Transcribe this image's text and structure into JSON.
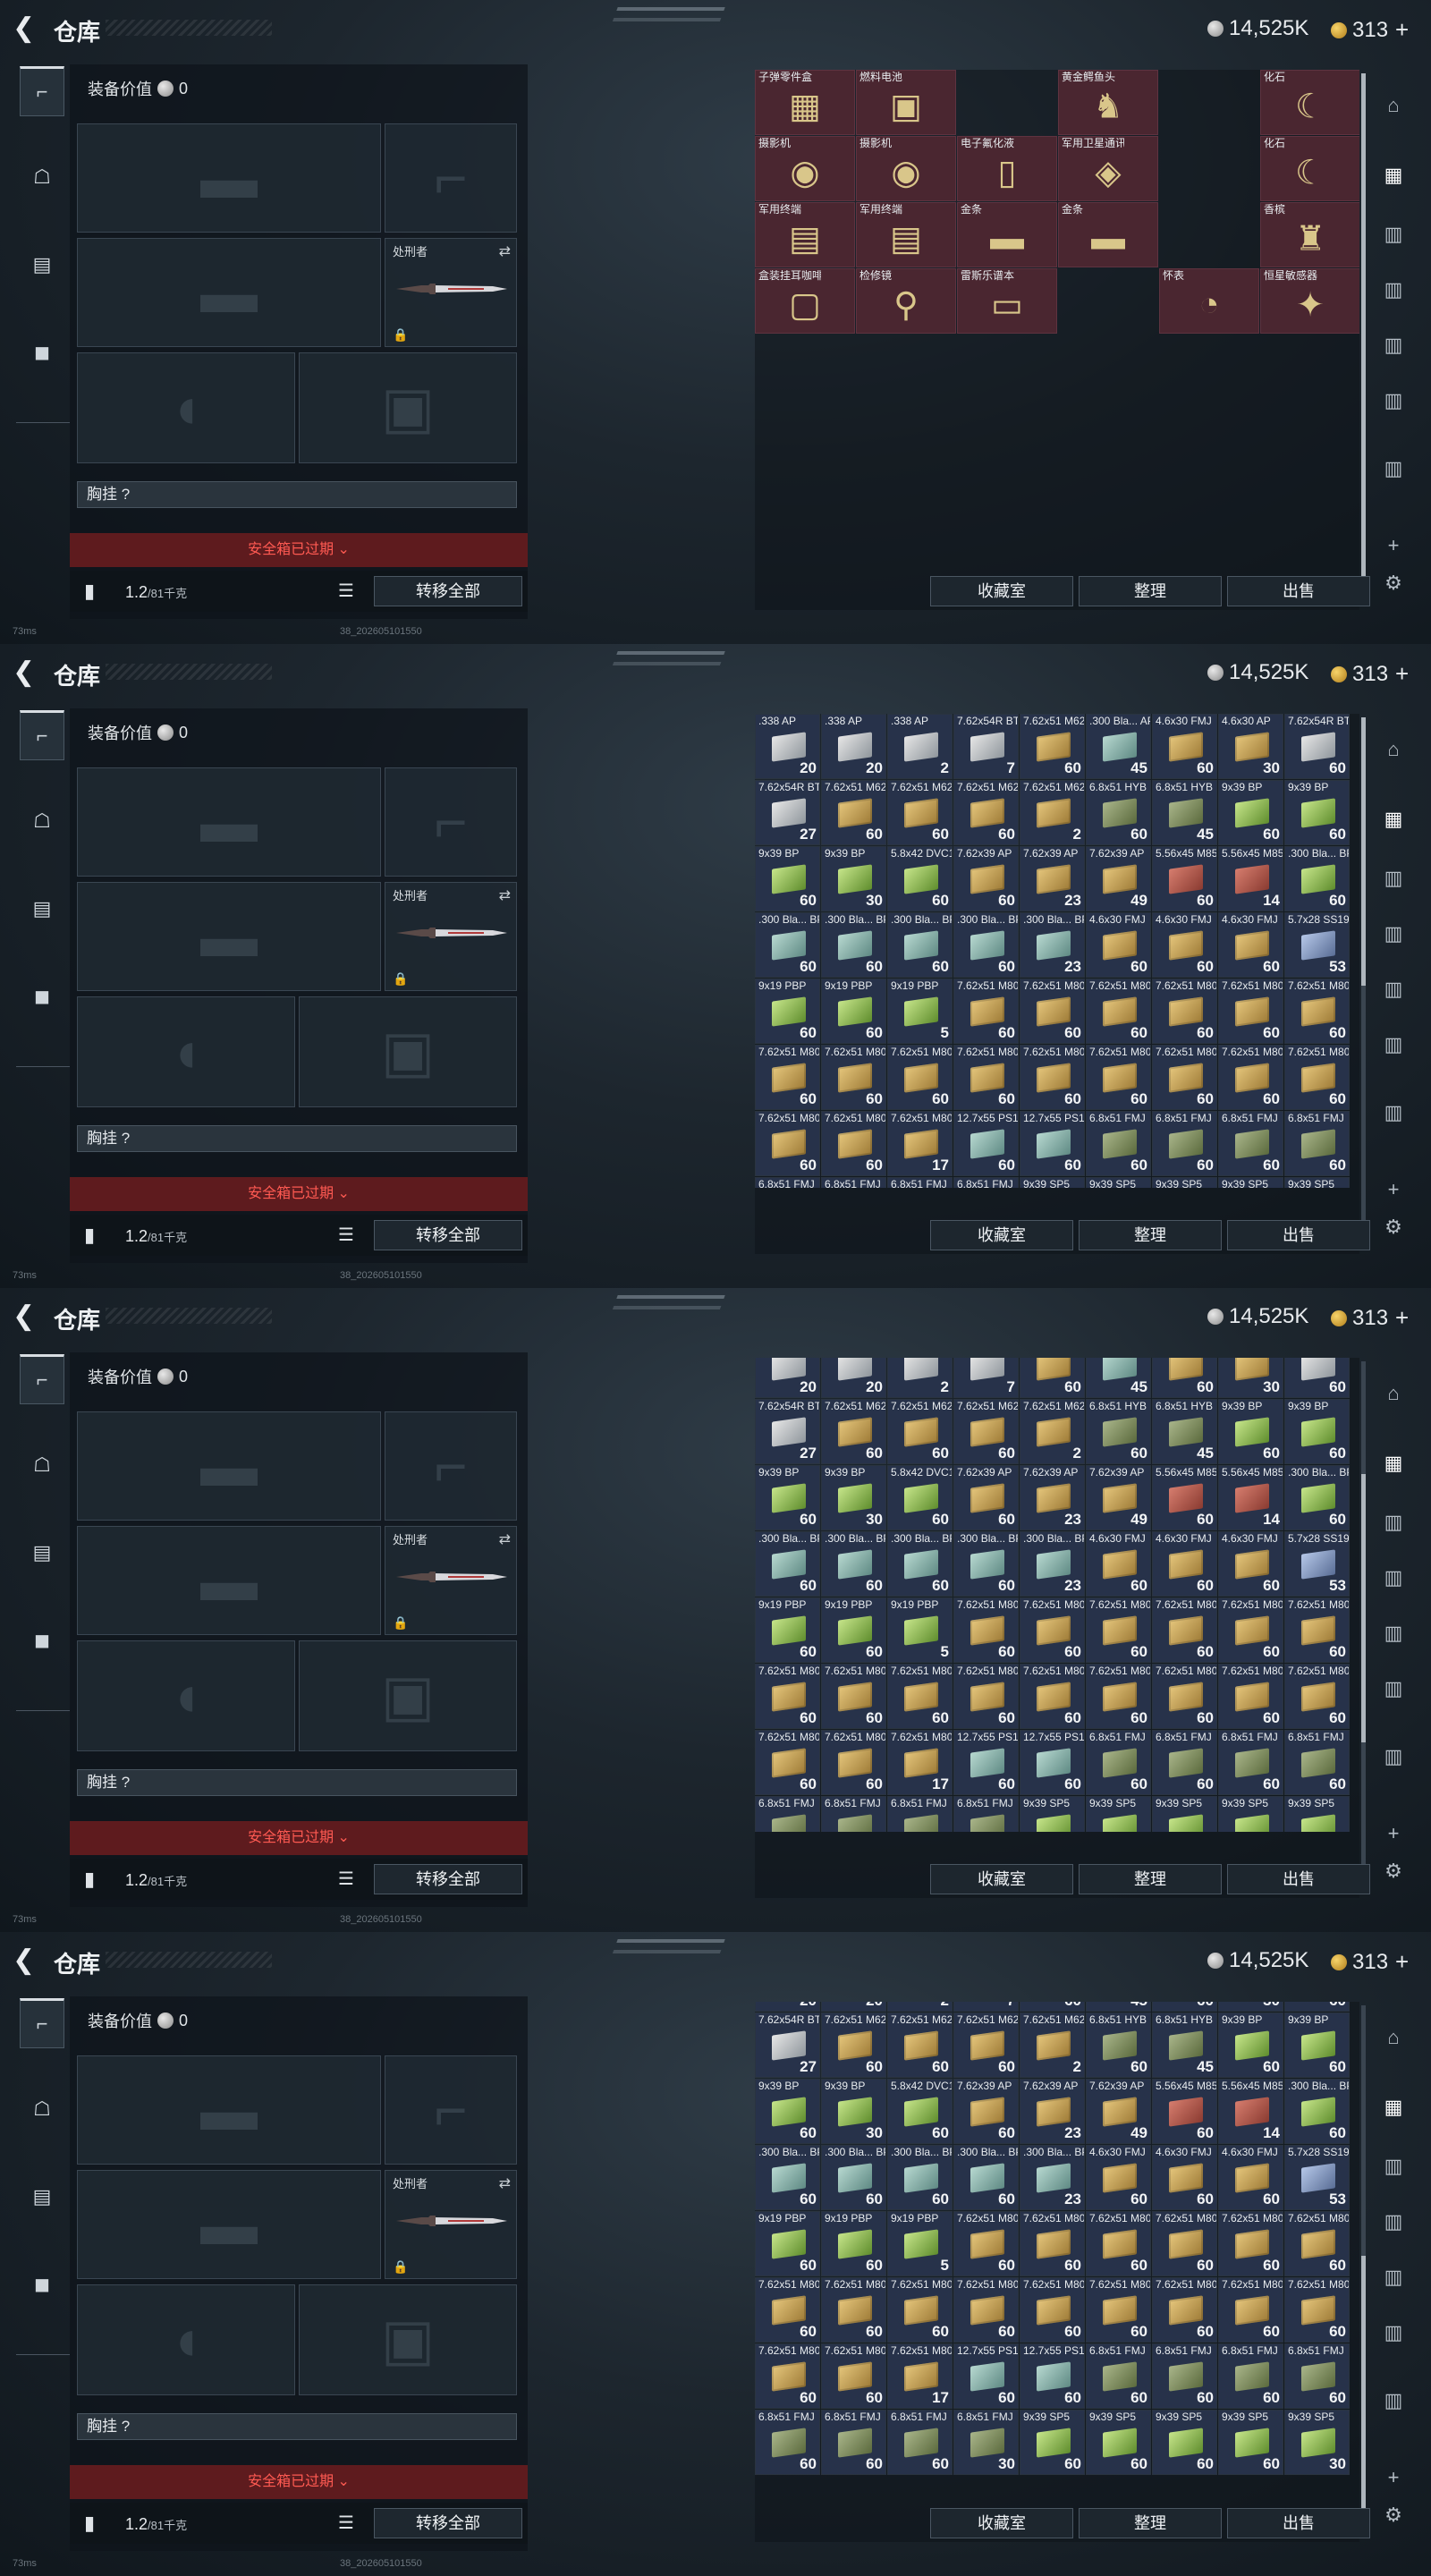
{
  "frames": [
    {
      "id": "frame-1",
      "view": "valuables"
    },
    {
      "id": "frame-2",
      "view": "ammo-top"
    },
    {
      "id": "frame-3",
      "view": "ammo-mid"
    },
    {
      "id": "frame-4",
      "view": "ammo-bottom"
    }
  ],
  "header": {
    "back_icon": "back-arrow-icon",
    "title": "仓库",
    "silver": "14,525K",
    "gold": "313",
    "plus": "+"
  },
  "gear": {
    "equip_value_label": "装备价值",
    "equip_value": "0",
    "knife_label": "处刑者",
    "chest_rig": "胸挂 ?",
    "safe_box": "安全箱已过期 ⌄",
    "weight": "1.2",
    "weight_max": "/81千克",
    "transfer_all": "转移全部"
  },
  "status": {
    "ping": "73ms",
    "build": "38_202605101550"
  },
  "actions": {
    "collection": "收藏室",
    "organize": "整理",
    "sell": "出售"
  },
  "valuables": [
    {
      "name": "子弹零件盒",
      "art": "▦"
    },
    {
      "name": "燃料电池",
      "art": "▣"
    },
    {
      "name": "",
      "art": ""
    },
    {
      "name": "黄金鳄鱼头",
      "art": "♞"
    },
    {
      "name": "",
      "art": ""
    },
    {
      "name": "化石",
      "art": "☾"
    },
    {
      "name": "摄影机",
      "art": "◉"
    },
    {
      "name": "摄影机",
      "art": "◉"
    },
    {
      "name": "电子氟化液",
      "art": "▯"
    },
    {
      "name": "军用卫星通讯仪",
      "art": "◈"
    },
    {
      "name": "",
      "art": ""
    },
    {
      "name": "化石",
      "art": "☾"
    },
    {
      "name": "军用终端",
      "art": "▤"
    },
    {
      "name": "军用终端",
      "art": "▤"
    },
    {
      "name": "金条",
      "art": "▬"
    },
    {
      "name": "金条",
      "art": "▬"
    },
    {
      "name": "",
      "art": ""
    },
    {
      "name": "香槟",
      "art": "♜"
    },
    {
      "name": "盒装挂耳咖啡",
      "art": "▢"
    },
    {
      "name": "检修镜",
      "art": "⚲"
    },
    {
      "name": "雷斯乐谱本",
      "art": "▭"
    },
    {
      "name": "",
      "art": ""
    },
    {
      "name": "怀表",
      "art": "◔"
    },
    {
      "name": "恒星敏感器",
      "art": "✦"
    }
  ],
  "ammo": [
    {
      "name": ".338 AP",
      "qty": 20,
      "color": "gray"
    },
    {
      "name": ".338 AP",
      "qty": 20,
      "color": "gray"
    },
    {
      "name": ".338 AP",
      "qty": 2,
      "color": "gray"
    },
    {
      "name": "7.62x54R BT",
      "qty": 7,
      "color": "gray"
    },
    {
      "name": "7.62x51 M62",
      "qty": 60,
      "color": "tan"
    },
    {
      "name": ".300 Bla... AP",
      "qty": 45,
      "color": "teal"
    },
    {
      "name": "4.6x30 FMJ",
      "qty": 60,
      "color": "tan"
    },
    {
      "name": "4.6x30 AP",
      "qty": 30,
      "color": "tan"
    },
    {
      "name": "7.62x54R BT",
      "qty": 60,
      "color": "gray"
    },
    {
      "name": "7.62x54R BT",
      "qty": 27,
      "color": "gray"
    },
    {
      "name": "7.62x51 M62",
      "qty": 60,
      "color": "tan"
    },
    {
      "name": "7.62x51 M62",
      "qty": 60,
      "color": "tan"
    },
    {
      "name": "7.62x51 M62",
      "qty": 60,
      "color": "tan"
    },
    {
      "name": "7.62x51 M62",
      "qty": 2,
      "color": "tan"
    },
    {
      "name": "6.8x51 HYB",
      "qty": 60,
      "color": "olive"
    },
    {
      "name": "6.8x51 HYB",
      "qty": 45,
      "color": "olive"
    },
    {
      "name": "9x39 BP",
      "qty": 60,
      "color": "green"
    },
    {
      "name": "9x39 BP",
      "qty": 60,
      "color": "green"
    },
    {
      "name": "9x39 BP",
      "qty": 60,
      "color": "green"
    },
    {
      "name": "9x39 BP",
      "qty": 30,
      "color": "green"
    },
    {
      "name": "5.8x42 DVC12",
      "qty": 60,
      "color": "green"
    },
    {
      "name": "7.62x39 AP",
      "qty": 60,
      "color": "tan"
    },
    {
      "name": "7.62x39 AP",
      "qty": 23,
      "color": "tan"
    },
    {
      "name": "7.62x39 AP",
      "qty": 49,
      "color": "tan"
    },
    {
      "name": "5.56x45 M855",
      "qty": 60,
      "color": "red"
    },
    {
      "name": "5.56x45 M855",
      "qty": 14,
      "color": "red"
    },
    {
      "name": ".300 Bla... BP",
      "qty": 60,
      "color": "green"
    },
    {
      "name": ".300 Bla... BP FMJ",
      "qty": 60,
      "color": "teal"
    },
    {
      "name": ".300 Bla... BP FMJ",
      "qty": 60,
      "color": "teal"
    },
    {
      "name": ".300 Bla... BP FMJ",
      "qty": 60,
      "color": "teal"
    },
    {
      "name": ".300 Bla... BP FMJ",
      "qty": 60,
      "color": "teal"
    },
    {
      "name": ".300 Bla... BP FMJ",
      "qty": 23,
      "color": "teal"
    },
    {
      "name": "4.6x30 FMJ",
      "qty": 60,
      "color": "tan"
    },
    {
      "name": "4.6x30 FMJ",
      "qty": 60,
      "color": "tan"
    },
    {
      "name": "4.6x30 FMJ",
      "qty": 60,
      "color": "tan"
    },
    {
      "name": "5.7x28 SS190",
      "qty": 53,
      "color": "blue"
    },
    {
      "name": "9x19 PBP",
      "qty": 60,
      "color": "green"
    },
    {
      "name": "9x19 PBP",
      "qty": 60,
      "color": "green"
    },
    {
      "name": "9x19 PBP",
      "qty": 5,
      "color": "green"
    },
    {
      "name": "7.62x51 M80",
      "qty": 60,
      "color": "tan"
    },
    {
      "name": "7.62x51 M80",
      "qty": 60,
      "color": "tan"
    },
    {
      "name": "7.62x51 M80",
      "qty": 60,
      "color": "tan"
    },
    {
      "name": "7.62x51 M80",
      "qty": 60,
      "color": "tan"
    },
    {
      "name": "7.62x51 M80",
      "qty": 60,
      "color": "tan"
    },
    {
      "name": "7.62x51 M80",
      "qty": 60,
      "color": "tan"
    },
    {
      "name": "7.62x51 M80",
      "qty": 60,
      "color": "tan"
    },
    {
      "name": "7.62x51 M80",
      "qty": 60,
      "color": "tan"
    },
    {
      "name": "7.62x51 M80",
      "qty": 60,
      "color": "tan"
    },
    {
      "name": "7.62x51 M80",
      "qty": 60,
      "color": "tan"
    },
    {
      "name": "7.62x51 M80",
      "qty": 60,
      "color": "tan"
    },
    {
      "name": "7.62x51 M80",
      "qty": 60,
      "color": "tan"
    },
    {
      "name": "7.62x51 M80",
      "qty": 60,
      "color": "tan"
    },
    {
      "name": "7.62x51 M80",
      "qty": 60,
      "color": "tan"
    },
    {
      "name": "7.62x51 M80",
      "qty": 60,
      "color": "tan"
    },
    {
      "name": "7.62x51 M80",
      "qty": 60,
      "color": "tan"
    },
    {
      "name": "7.62x51 M80",
      "qty": 60,
      "color": "tan"
    },
    {
      "name": "7.62x51 M80",
      "qty": 17,
      "color": "tan"
    },
    {
      "name": "12.7x55 PS12A",
      "qty": 60,
      "color": "teal"
    },
    {
      "name": "12.7x55 PS12A",
      "qty": 60,
      "color": "teal"
    },
    {
      "name": "6.8x51 FMJ",
      "qty": 60,
      "color": "olive"
    },
    {
      "name": "6.8x51 FMJ",
      "qty": 60,
      "color": "olive"
    },
    {
      "name": "6.8x51 FMJ",
      "qty": 60,
      "color": "olive"
    },
    {
      "name": "6.8x51 FMJ",
      "qty": 60,
      "color": "olive"
    },
    {
      "name": "6.8x51 FMJ",
      "qty": 60,
      "color": "olive"
    },
    {
      "name": "6.8x51 FMJ",
      "qty": 60,
      "color": "olive"
    },
    {
      "name": "6.8x51 FMJ",
      "qty": 60,
      "color": "olive"
    },
    {
      "name": "6.8x51 FMJ",
      "qty": 30,
      "color": "olive"
    },
    {
      "name": "9x39 SP5",
      "qty": 60,
      "color": "green"
    },
    {
      "name": "9x39 SP5",
      "qty": 60,
      "color": "green"
    },
    {
      "name": "9x39 SP5",
      "qty": 60,
      "color": "green"
    },
    {
      "name": "9x39 SP5",
      "qty": 60,
      "color": "green"
    },
    {
      "name": "9x39 SP5",
      "qty": 30,
      "color": "green"
    }
  ],
  "scroll": [
    0.0,
    0.0,
    0.45,
    1.0
  ],
  "colors": {
    "valuable_bg": "#4a2630",
    "ammo_bg": "#27324a",
    "accent_red": "#ff5a52"
  },
  "icons": {
    "left_tabs": [
      "weapon-icon",
      "armor-icon",
      "clipboard-icon",
      "briefcase-icon"
    ],
    "right_nav": [
      "home-icon",
      "storage-1-icon",
      "storage-2-icon",
      "storage-3-icon",
      "storage-4-icon",
      "storage-5-icon",
      "storage-6-icon",
      "add-icon",
      "settings-icon"
    ]
  }
}
